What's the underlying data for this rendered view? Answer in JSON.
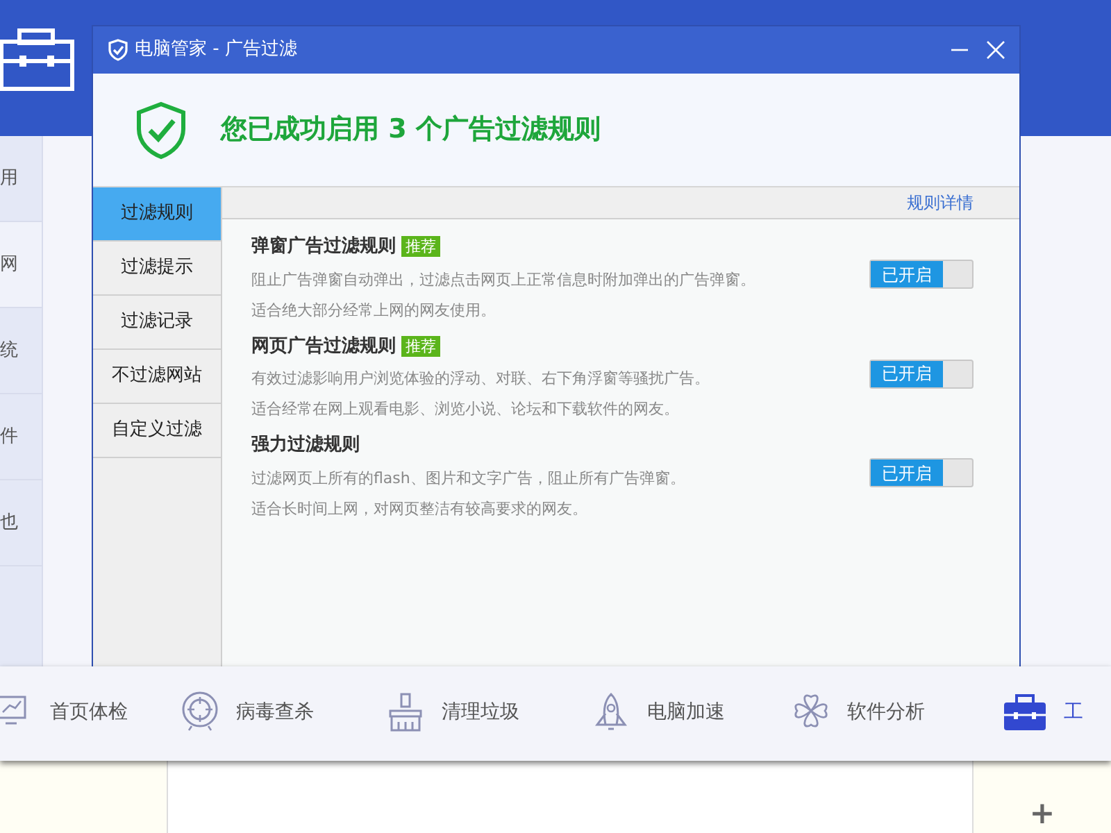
{
  "background_app": {
    "sidebar": [
      "用",
      "网",
      "统",
      "件",
      "也"
    ],
    "nav": [
      {
        "label": "首页体检",
        "kind": "monitor",
        "selected": false
      },
      {
        "label": "病毒查杀",
        "kind": "target",
        "selected": false
      },
      {
        "label": "清理垃圾",
        "kind": "brush",
        "selected": false
      },
      {
        "label": "电脑加速",
        "kind": "rocket",
        "selected": false
      },
      {
        "label": "软件分析",
        "kind": "clover",
        "selected": false
      },
      {
        "label": "工",
        "kind": "toolbox",
        "selected": true
      }
    ],
    "side_buttons": [
      "+"
    ]
  },
  "window": {
    "title": "电脑管家 - 广告过滤",
    "header": "您已成功启用 3 个广告过滤规则",
    "tabs": [
      {
        "label": "过滤规则",
        "selected": true
      },
      {
        "label": "过滤提示",
        "selected": false
      },
      {
        "label": "过滤记录",
        "selected": false
      },
      {
        "label": "不过滤网站",
        "selected": false
      },
      {
        "label": "自定义过滤",
        "selected": false
      }
    ],
    "details_link": "规则详情",
    "rules": [
      {
        "title": "弹窗广告过滤规则",
        "badge": "推荐",
        "description": "阻止广告弹窗自动弹出，过滤点击网页上正常信息时附加弹出的广告弹窗。",
        "note": "适合绝大部分经常上网的网友使用。",
        "switch_label": "已开启",
        "on": true
      },
      {
        "title": "网页广告过滤规则",
        "badge": "推荐",
        "description": "有效过滤影响用户浏览体验的浮动、对联、右下角浮窗等骚扰广告。",
        "note": "适合经常在网上观看电影、浏览小说、论坛和下载软件的网友。",
        "switch_label": "已开启",
        "on": true
      },
      {
        "title": "强力过滤规则",
        "description": "过滤网页上所有的flash、图片和文字广告，阻止所有广告弹窗。",
        "note": "适合长时间上网，对网页整洁有较高要求的网友。",
        "switch_label": "已开启",
        "on": true
      }
    ]
  }
}
